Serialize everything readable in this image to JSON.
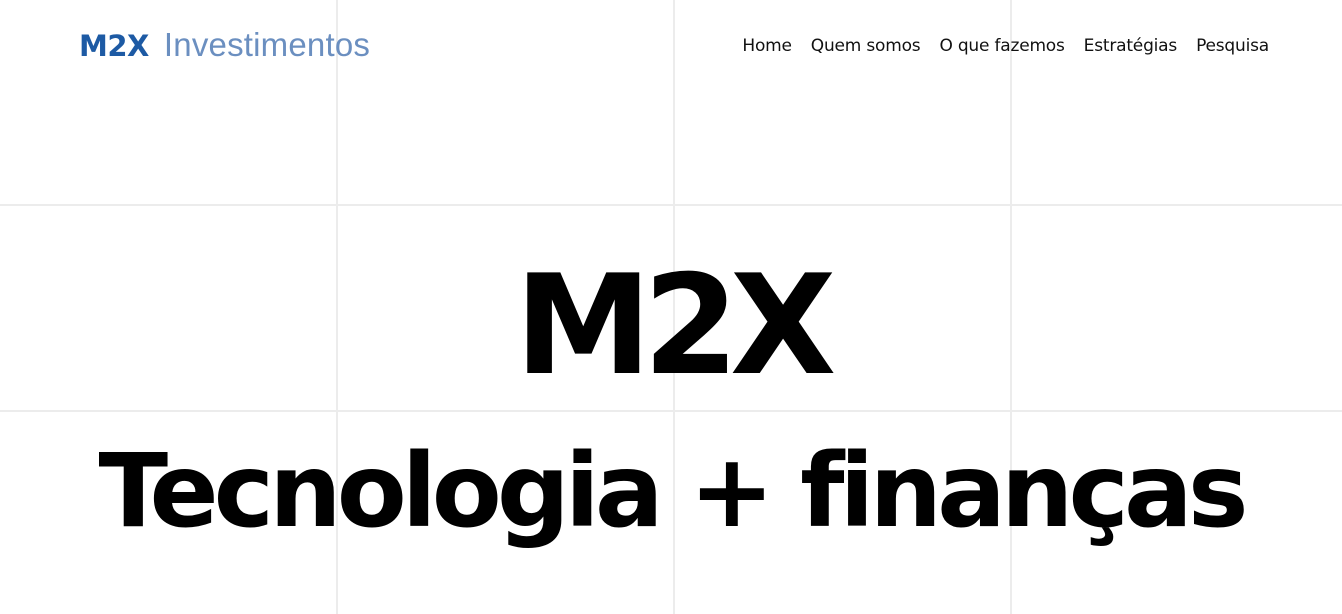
{
  "header": {
    "logo": {
      "mark": "M2X",
      "word": "Investimentos"
    },
    "nav": [
      {
        "label": "Home"
      },
      {
        "label": "Quem somos"
      },
      {
        "label": "O que fazemos"
      },
      {
        "label": "Estratégias"
      },
      {
        "label": "Pesquisa"
      }
    ]
  },
  "hero": {
    "title": "M2X",
    "subtitle": "Tecnologia + finanças"
  },
  "colors": {
    "logo_mark": "#1d5aa4",
    "logo_word": "#6b8fc0",
    "grid": "#ececec",
    "text": "#000000"
  }
}
